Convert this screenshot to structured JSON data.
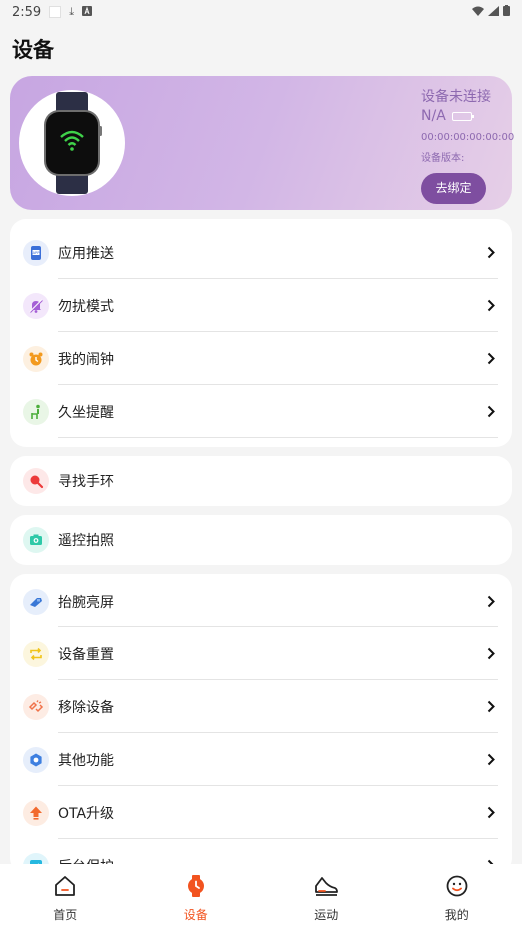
{
  "status_bar": {
    "time": "2:59"
  },
  "page": {
    "title": "设备"
  },
  "device_card": {
    "connection_status": "设备未连接",
    "device_name": "N/A",
    "mac": "00:00:00:00:00:00",
    "version_label": "设备版本:",
    "unbind_label": "去绑定"
  },
  "group1": [
    {
      "label": "应用推送",
      "icon": "app-push-icon"
    },
    {
      "label": "勿扰模式",
      "icon": "do-not-disturb-icon"
    },
    {
      "label": "我的闹钟",
      "icon": "alarm-clock-icon"
    },
    {
      "label": "久坐提醒",
      "icon": "sedentary-reminder-icon"
    }
  ],
  "group2": [
    {
      "label": "寻找手环",
      "icon": "find-band-icon"
    }
  ],
  "group3": [
    {
      "label": "遥控拍照",
      "icon": "remote-camera-icon"
    }
  ],
  "group4": [
    {
      "label": "抬腕亮屏",
      "icon": "raise-wrist-icon"
    },
    {
      "label": "设备重置",
      "icon": "device-reset-icon"
    },
    {
      "label": "移除设备",
      "icon": "remove-device-icon"
    },
    {
      "label": "其他功能",
      "icon": "other-functions-icon"
    },
    {
      "label": "OTA升级",
      "icon": "ota-upgrade-icon"
    },
    {
      "label": "后台保护",
      "icon": "background-protection-icon"
    }
  ],
  "tabbar": [
    {
      "label": "首页",
      "icon": "home-icon",
      "active": false
    },
    {
      "label": "设备",
      "icon": "watch-icon",
      "active": true
    },
    {
      "label": "运动",
      "icon": "shoe-icon",
      "active": false
    },
    {
      "label": "我的",
      "icon": "smile-icon",
      "active": false
    }
  ],
  "colors": {
    "accent": "#f2531f",
    "card_purple": "#c7a6e2",
    "unbind_button": "#7e4ea0"
  }
}
